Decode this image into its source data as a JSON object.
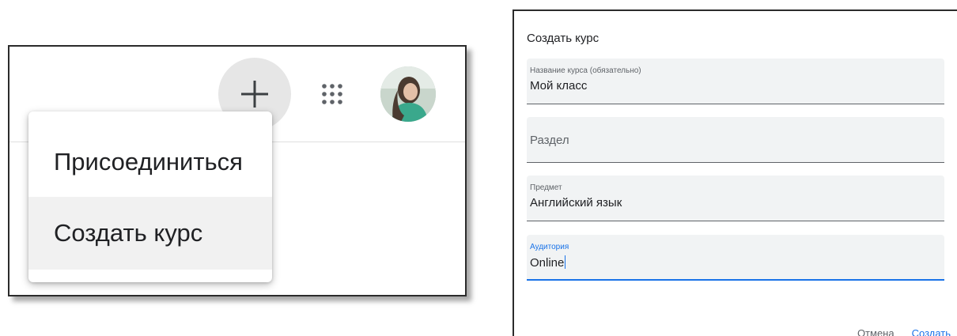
{
  "menu": {
    "items": [
      {
        "label": "Присоединиться"
      },
      {
        "label": "Создать курс"
      }
    ]
  },
  "topbar": {
    "plus_icon": "plus-icon",
    "apps_icon": "apps-grid-icon",
    "avatar": "user-avatar"
  },
  "dialog": {
    "title": "Создать курс",
    "fields": [
      {
        "label": "Название курса (обязательно)",
        "value": "Мой класс"
      },
      {
        "label": "",
        "placeholder": "Раздел",
        "value": ""
      },
      {
        "label": "Предмет",
        "value": "Английский язык"
      },
      {
        "label": "Аудитория",
        "value": "Online"
      }
    ],
    "cancel_label": "Отмена",
    "create_label": "Создать"
  },
  "colors": {
    "accent": "#1a73e8",
    "field_bg": "#f1f3f4",
    "text": "#202124",
    "secondary_text": "#5f6368"
  }
}
